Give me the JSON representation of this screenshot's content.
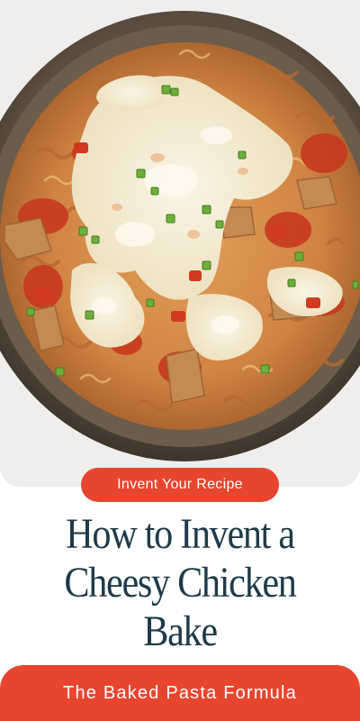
{
  "pin": {
    "badge_label": "Invent Your Recipe",
    "title": "How to Invent a Cheesy Chicken Bake",
    "footer_label": "The Baked Pasta Formula"
  },
  "colors": {
    "accent": "#e8452f",
    "title_text": "#1f3a4a",
    "background": "#ffffff"
  },
  "photo": {
    "subject": "baked rotini pasta with chicken, tomato sauce, melted cheese and green onions in a round pan"
  }
}
